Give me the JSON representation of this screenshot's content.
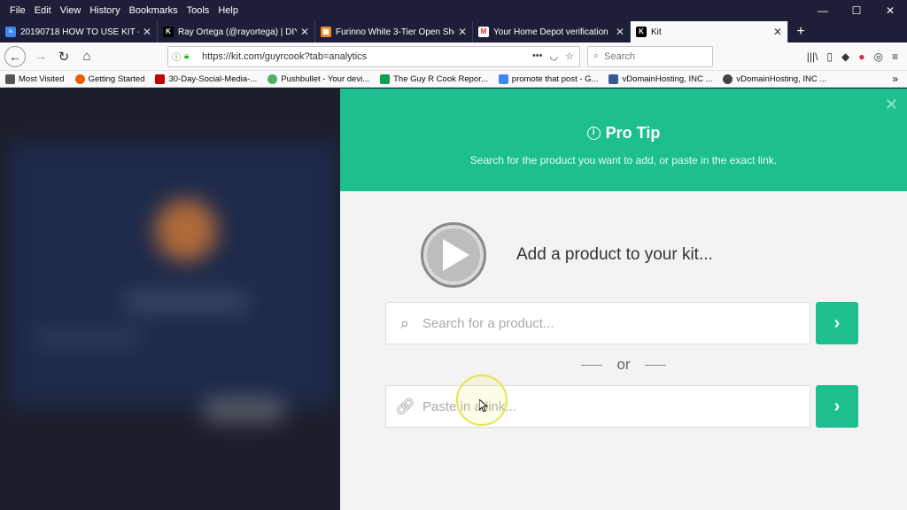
{
  "menu": [
    "File",
    "Edit",
    "View",
    "History",
    "Bookmarks",
    "Tools",
    "Help"
  ],
  "window_controls": {
    "minimize": "—",
    "maximize": "☐",
    "close": "✕"
  },
  "tabs": [
    {
      "title": "20190718 HOW TO USE KIT - G",
      "favicon_color": "#4285f4",
      "active": false
    },
    {
      "title": "Ray Ortega (@rayortega) | DIY",
      "favicon_color": "#000000",
      "active": false
    },
    {
      "title": "Furinno White 3-Tier Open She",
      "favicon_color": "#f08a24",
      "active": false
    },
    {
      "title": "Your Home Depot verification",
      "favicon_color": "#d93025",
      "active": false
    },
    {
      "title": "Kit",
      "favicon_color": "#000000",
      "active": true
    }
  ],
  "new_tab": "+",
  "url": "https://kit.com/guyrcook?tab=analytics",
  "search_placeholder": "Search",
  "bookmarks": [
    {
      "label": "Most Visited",
      "color": "#555555"
    },
    {
      "label": "Getting Started",
      "color": "#e66000"
    },
    {
      "label": "30-Day-Social-Media-...",
      "color": "#c00000"
    },
    {
      "label": "Pushbullet - Your devi...",
      "color": "#4ab367"
    },
    {
      "label": "The Guy R Cook Repor...",
      "color": "#0f9d58"
    },
    {
      "label": "promote that post - G...",
      "color": "#4285f4"
    },
    {
      "label": "vDomainHosting, INC ...",
      "color": "#3b5998"
    },
    {
      "label": "vDomainHosting, INC ...",
      "color": "#444444"
    }
  ],
  "panel": {
    "close": "✕",
    "tip_title": "Pro Tip",
    "tip_subtitle": "Search for the product you want to add, or paste in the exact link.",
    "add_text": "Add a product to your kit...",
    "search_placeholder": "Search for a product...",
    "or_text": "or",
    "link_placeholder": "Paste in a link...",
    "go_label": "›",
    "accent": "#1dbf8f"
  }
}
